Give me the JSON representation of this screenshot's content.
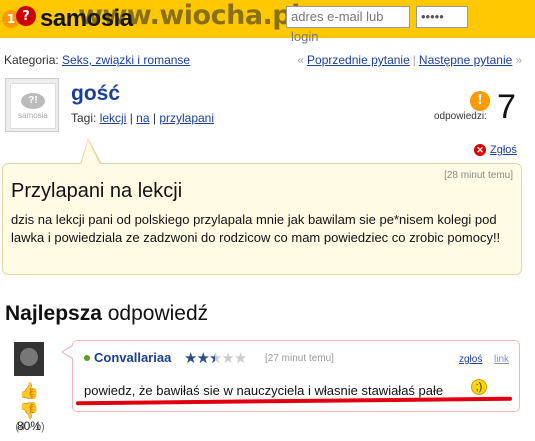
{
  "header": {
    "logo_text": "samosia",
    "watermark": "www.wiocha.pl",
    "email_placeholder": "adres e-mail lub login",
    "password_value": "•••••"
  },
  "category": {
    "label": "Kategoria:",
    "value": "Seks, związki i romanse"
  },
  "navigation": {
    "prev_label": "« Poprzednie pytanie",
    "prev_link": "Poprzednie pytanie",
    "next_link": "Następne pytanie",
    "next_suffix": "»"
  },
  "asker": {
    "name": "gość",
    "avatar_label": "samosia",
    "tags_label": "Tagi:",
    "tags": [
      "lekcji",
      "na",
      "przylapani"
    ]
  },
  "answers": {
    "label": "odpowiedzi:",
    "count": "7"
  },
  "report_label": "Zgłoś",
  "question": {
    "time": "[28 minut temu]",
    "title": "Przylapani na lekcji",
    "body": "dzis na lekcji pani od polskiego przylapala mnie jak bawilam sie pe*nisem kolegi pod lawka i powiedziala ze zadzwoni do rodzicow co mam powiedziec co zrobic pomocy!!"
  },
  "best_answer": {
    "heading_bold": "Najlepsza",
    "heading_rest": "odpowiedź",
    "user": "Convallariaa",
    "rating_stars": 2.5,
    "rating_max": 5,
    "time": "[27 minut temu]",
    "report_label": "zgłoś",
    "link_label": "link",
    "body": "powiedz, że bawiłaś sie w nauczyciela i własnie stawiałaś pałe",
    "votes": "(4 - 1)",
    "percent": "80%"
  },
  "colors": {
    "topbar": "#ffc800",
    "link": "#1a3fa0",
    "username": "#1a3f9a",
    "question_bg": "#fffbe5",
    "highlight": "#e0000f"
  }
}
